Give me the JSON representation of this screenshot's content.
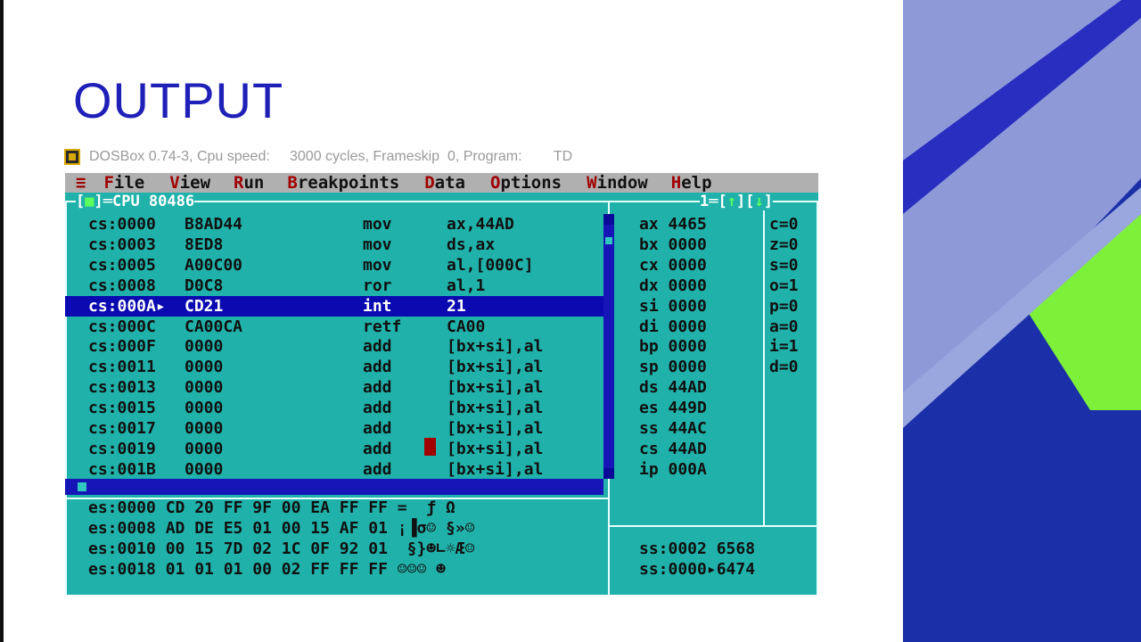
{
  "slide": {
    "title": "OUTPUT"
  },
  "dosbox": {
    "title": "DOSBox 0.74-3, Cpu speed:     3000 cycles, Frameskip  0, Program:        TD"
  },
  "menu": {
    "items": [
      {
        "hot": "F",
        "rest": "ile"
      },
      {
        "hot": "V",
        "rest": "iew"
      },
      {
        "hot": "R",
        "rest": "un"
      },
      {
        "hot": "B",
        "rest": "reakpoints"
      },
      {
        "hot": "D",
        "rest": "ata"
      },
      {
        "hot": "O",
        "rest": "ptions"
      },
      {
        "hot": "W",
        "rest": "indow"
      },
      {
        "hot": "H",
        "rest": "elp"
      }
    ],
    "system": "≡"
  },
  "cpu_window": {
    "label": "CPU 80486",
    "window_number": "1",
    "close_marker": "■",
    "up_arrow": "↑",
    "down_arrow": "↓"
  },
  "code": [
    {
      "addr": "cs:0000",
      "bytes": "B8AD44",
      "mnem": "mov",
      "ops": "ax,44AD"
    },
    {
      "addr": "cs:0003",
      "bytes": "8ED8",
      "mnem": "mov",
      "ops": "ds,ax"
    },
    {
      "addr": "cs:0005",
      "bytes": "A00C00",
      "mnem": "mov",
      "ops": "al,[000C]"
    },
    {
      "addr": "cs:0008",
      "bytes": "D0C8",
      "mnem": "ror",
      "ops": "al,1"
    },
    {
      "addr": "cs:000A▸",
      "bytes": "CD21",
      "mnem": "int",
      "ops": "21"
    },
    {
      "addr": "cs:000C",
      "bytes": "CA00CA",
      "mnem": "retf",
      "ops": "CA00"
    },
    {
      "addr": "cs:000F",
      "bytes": "0000",
      "mnem": "add",
      "ops": "[bx+si],al"
    },
    {
      "addr": "cs:0011",
      "bytes": "0000",
      "mnem": "add",
      "ops": "[bx+si],al"
    },
    {
      "addr": "cs:0013",
      "bytes": "0000",
      "mnem": "add",
      "ops": "[bx+si],al"
    },
    {
      "addr": "cs:0015",
      "bytes": "0000",
      "mnem": "add",
      "ops": "[bx+si],al"
    },
    {
      "addr": "cs:0017",
      "bytes": "0000",
      "mnem": "add",
      "ops": "[bx+si],al"
    },
    {
      "addr": "cs:0019",
      "bytes": "0000",
      "mnem": "add",
      "ops": "[bx+si],al"
    },
    {
      "addr": "cs:001B",
      "bytes": "0000",
      "mnem": "add",
      "ops": "[bx+si],al"
    }
  ],
  "selected_row": 4,
  "registers": [
    "ax 4465",
    "bx 0000",
    "cx 0000",
    "dx 0000",
    "si 0000",
    "di 0000",
    "bp 0000",
    "sp 0000",
    "ds 44AD",
    "es 449D",
    "ss 44AC",
    "cs 44AD",
    "ip 000A"
  ],
  "flags": [
    "c=0",
    "z=0",
    "s=0",
    "o=1",
    "p=0",
    "a=0",
    "i=1",
    "d=0"
  ],
  "dump": [
    "es:0000 CD 20 FF 9F 00 EA FF FF =  ƒ Ω",
    "es:0008 AD DE E5 01 00 15 AF 01 ¡▐σ☺ §»☺",
    "es:0010 00 15 7D 02 1C 0F 92 01  §}☻∟☼Æ☺",
    "es:0018 01 01 01 00 02 FF FF FF ☺☺☺ ☻"
  ],
  "stack": [
    "ss:0002 6568",
    "ss:0000▸6474"
  ],
  "colors": {
    "screen": "#20b2aa",
    "selection": "#0a0ab0",
    "menubar": "#b0b0b0",
    "hotkey": "#a00000",
    "title": "#1f20b8"
  }
}
